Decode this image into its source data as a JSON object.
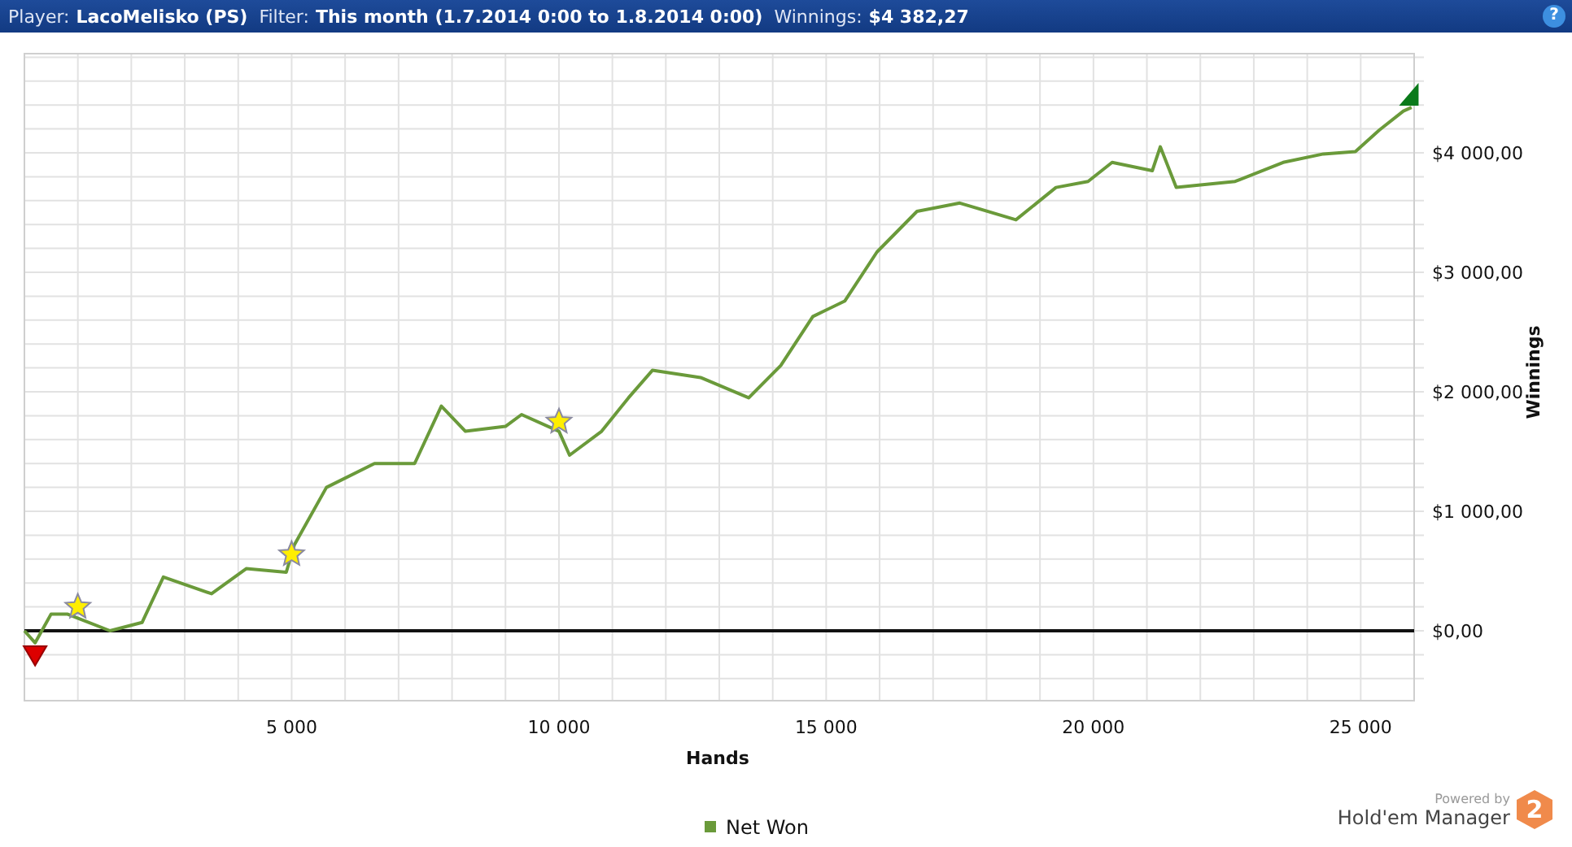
{
  "header": {
    "fields": [
      {
        "label": "Player:",
        "value": "LacoMelisko (PS)"
      },
      {
        "label": "Filter:",
        "value": "This month (1.7.2014 0:00 to 1.8.2014 0:00)"
      },
      {
        "label": "Winnings:",
        "value": "$4 382,27"
      }
    ],
    "help": "?"
  },
  "chart": {
    "chart_data": {
      "type": "line",
      "xlabel": "Hands",
      "ylabel": "Winnings",
      "xlim": [
        0,
        26000
      ],
      "ylim": [
        -585,
        4830
      ],
      "xticks": [
        {
          "value": 5000,
          "label": "5 000"
        },
        {
          "value": 10000,
          "label": "10 000"
        },
        {
          "value": 15000,
          "label": "15 000"
        },
        {
          "value": 20000,
          "label": "20 000"
        },
        {
          "value": 25000,
          "label": "25 000"
        }
      ],
      "yticks": [
        {
          "value": 0,
          "label": "$0,00"
        },
        {
          "value": 1000,
          "label": "$1 000,00"
        },
        {
          "value": 2000,
          "label": "$2 000,00"
        },
        {
          "value": 3000,
          "label": "$3 000,00"
        },
        {
          "value": 4000,
          "label": "$4 000,00"
        }
      ],
      "x": [
        0,
        200,
        500,
        800,
        1600,
        2200,
        2600,
        3500,
        4150,
        4900,
        5050,
        5650,
        6550,
        7300,
        7800,
        8250,
        9000,
        9300,
        10000,
        10200,
        10800,
        11300,
        11750,
        12650,
        13550,
        14150,
        14750,
        15350,
        15950,
        16700,
        17500,
        18550,
        19300,
        19900,
        20350,
        21100,
        21250,
        21550,
        22650,
        23550,
        24300,
        24900,
        25350,
        25800,
        25950
      ],
      "series": [
        {
          "name": "Net Won",
          "color": "#6a9a3a",
          "values": [
            0,
            -100,
            140,
            140,
            0,
            70,
            450,
            310,
            520,
            490,
            720,
            1200,
            1400,
            1400,
            1880,
            1670,
            1710,
            1810,
            1670,
            1470,
            1670,
            1950,
            2180,
            2120,
            1950,
            2220,
            2630,
            2760,
            3170,
            3510,
            3580,
            3440,
            3710,
            3760,
            3920,
            3850,
            4050,
            3710,
            3760,
            3920,
            3990,
            4010,
            4190,
            4350,
            4380
          ]
        }
      ],
      "grid": true
    },
    "markers": [
      {
        "kind": "star"
      },
      {
        "kind": "star"
      },
      {
        "kind": "star"
      },
      {
        "kind": "low"
      },
      {
        "kind": "high"
      }
    ]
  },
  "branding": {
    "caption": "Powered by",
    "name": "Hold'em Manager",
    "badge": "2"
  }
}
